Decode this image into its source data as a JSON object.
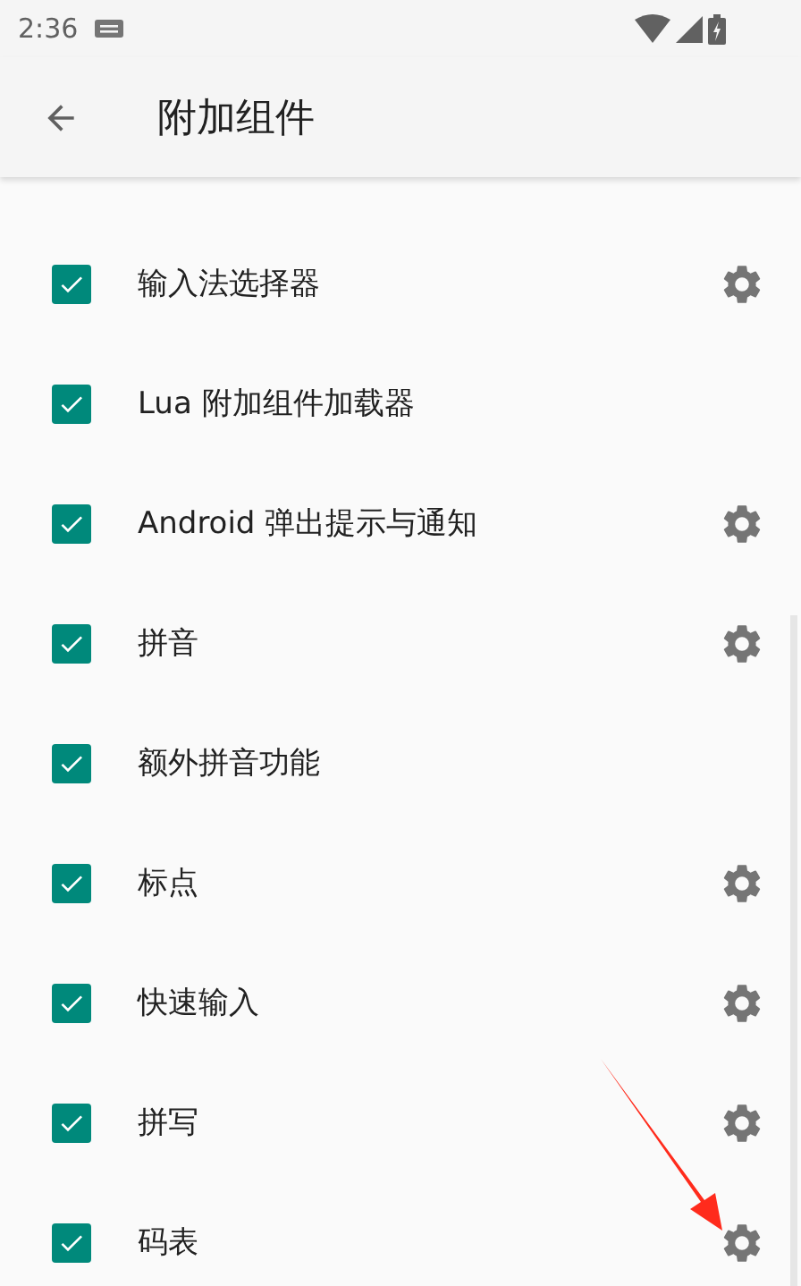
{
  "status_bar": {
    "time": "2:36"
  },
  "app_bar": {
    "title": "附加组件"
  },
  "items": [
    {
      "label": "输入法选择器",
      "checked": true,
      "has_settings": true
    },
    {
      "label": "Lua 附加组件加载器",
      "checked": true,
      "has_settings": false
    },
    {
      "label": "Android 弹出提示与通知",
      "checked": true,
      "has_settings": true
    },
    {
      "label": "拼音",
      "checked": true,
      "has_settings": true
    },
    {
      "label": "额外拼音功能",
      "checked": true,
      "has_settings": false
    },
    {
      "label": "标点",
      "checked": true,
      "has_settings": true
    },
    {
      "label": "快速输入",
      "checked": true,
      "has_settings": true
    },
    {
      "label": "拼写",
      "checked": true,
      "has_settings": true
    },
    {
      "label": "码表",
      "checked": true,
      "has_settings": true
    }
  ]
}
